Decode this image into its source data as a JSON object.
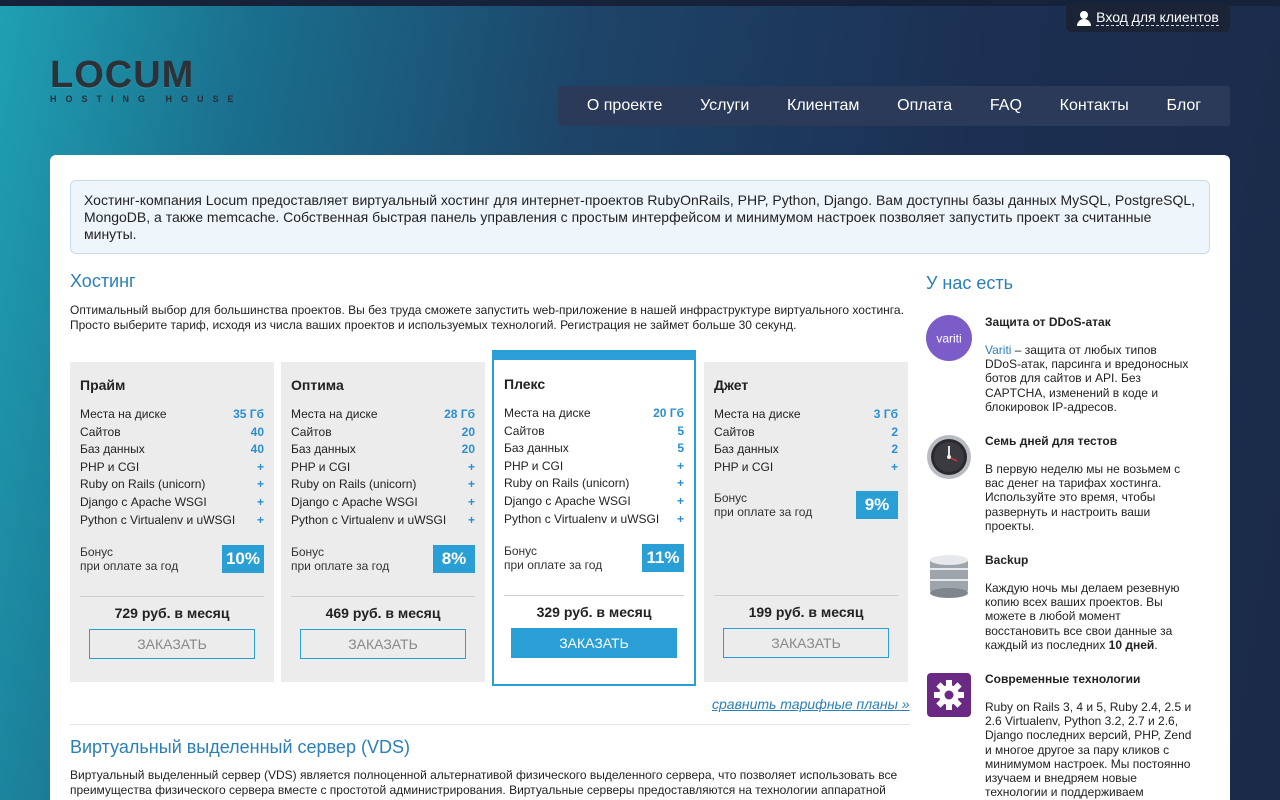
{
  "header": {
    "login_label": "Вход для клиентов",
    "logo_main": "LOCUM",
    "logo_sub": "HOSTING HOUSE",
    "nav": [
      "О проекте",
      "Услуги",
      "Клиентам",
      "Оплата",
      "FAQ",
      "Контакты",
      "Блог"
    ]
  },
  "intro": "Хостинг-компания Locum предоставляет виртуальный хостинг для интернет-проектов RubyOnRails, PHP, Python, Django. Вам доступны базы данных MySQL, PostgreSQL, MongoDB, а также memcache. Собственная быстрая панель управления с простым интерфейсом и минимумом настроек позволяет запустить проект за считанные минуты.",
  "hosting": {
    "title": "Хостинг",
    "description": "Оптимальный выбор для большинства проектов. Вы без труда сможете запустить web-приложение в нашей инфраструктуре виртуального хостинга. Просто выберите тариф, исходя из числа ваших проектов и используемых технологий. Регистрация не займет больше 30 секунд.",
    "bonus_label": "Бонус",
    "bonus_sub": "при оплате за год",
    "order_label": "ЗАКАЗАТЬ",
    "plans": [
      {
        "name": "Прайм",
        "rows": [
          [
            "Места на диске",
            "35 Гб"
          ],
          [
            "Сайтов",
            "40"
          ],
          [
            "Баз данных",
            "40"
          ],
          [
            "PHP и CGI",
            "+"
          ],
          [
            "Ruby on Rails (unicorn)",
            "+"
          ],
          [
            "Django с Apache WSGI",
            "+"
          ],
          [
            "Python с Virtualenv и uWSGI",
            "+"
          ]
        ],
        "bonus": "10%",
        "price": "729 руб. в месяц"
      },
      {
        "name": "Оптима",
        "rows": [
          [
            "Места на диске",
            "28 Гб"
          ],
          [
            "Сайтов",
            "20"
          ],
          [
            "Баз данных",
            "20"
          ],
          [
            "PHP и CGI",
            "+"
          ],
          [
            "Ruby on Rails (unicorn)",
            "+"
          ],
          [
            "Django с Apache WSGI",
            "+"
          ],
          [
            "Python с Virtualenv и uWSGI",
            "+"
          ]
        ],
        "bonus": "8%",
        "price": "469 руб. в месяц"
      },
      {
        "name": "Плекс",
        "rows": [
          [
            "Места на диске",
            "20 Гб"
          ],
          [
            "Сайтов",
            "5"
          ],
          [
            "Баз данных",
            "5"
          ],
          [
            "PHP и CGI",
            "+"
          ],
          [
            "Ruby on Rails (unicorn)",
            "+"
          ],
          [
            "Django с Apache WSGI",
            "+"
          ],
          [
            "Python с Virtualenv и uWSGI",
            "+"
          ]
        ],
        "bonus": "11%",
        "price": "329 руб. в месяц"
      },
      {
        "name": "Джет",
        "rows": [
          [
            "Места на диске",
            "3 Гб"
          ],
          [
            "Сайтов",
            "2"
          ],
          [
            "Баз данных",
            "2"
          ],
          [
            "PHP и CGI",
            "+"
          ]
        ],
        "bonus": "9%",
        "price": "199 руб. в месяц"
      }
    ],
    "compare_link": "сравнить тарифные планы »"
  },
  "vds": {
    "title": "Виртуальный выделенный сервер (VDS)",
    "description": "Виртуальный выделенный сервер (VDS) является полноценной альтернативой физического выделенного сервера, что позволяет использовать все преимущества физического сервера вместе с простотой администрирования. Виртуальные серверы предоставляются на технологии аппаратной"
  },
  "sidebar": {
    "title": "У нас есть",
    "items": [
      {
        "icon": "variti-logo",
        "icon_text": "variti",
        "title": "Защита от DDoS-атак",
        "link": "Variti",
        "text": " – защита от любых типов DDoS-атак, парсинга и вредоносных ботов для сайтов и API. Без CAPTCHA, изменений в коде и блокировок IP-адресов."
      },
      {
        "icon": "clock-icon",
        "title": "Семь дней для тестов",
        "text": "В первую неделю мы не возьмем с вас денег на тарифах хостинга. Используйте это время, чтобы развернуть и настроить ваши проекты."
      },
      {
        "icon": "database-icon",
        "title": "Backup",
        "text": "Каждую ночь мы делаем резевную копию всех ваших проектов. Вы можете в любой момент восстановить все свои данные за каждый из последних ",
        "text_bold": "10 дней",
        "text_end": "."
      },
      {
        "icon": "gear-icon",
        "title": "Современные технологии",
        "text": "Ruby on Rails 3, 4 и 5, Ruby 2.4, 2.5 и 2.6 Virtualenv, Python 3.2, 2.7 и 2.6, Django последних версий, PHP, Zend и многое другое за пару кликов с минимумом настроек. Мы постоянно изучаем и внедряем новые технологии и поддерживаем"
      }
    ]
  },
  "colors": {
    "accent": "#2a9fd6",
    "nav_bg": "#2a3a58",
    "link": "#2a7fb8"
  }
}
